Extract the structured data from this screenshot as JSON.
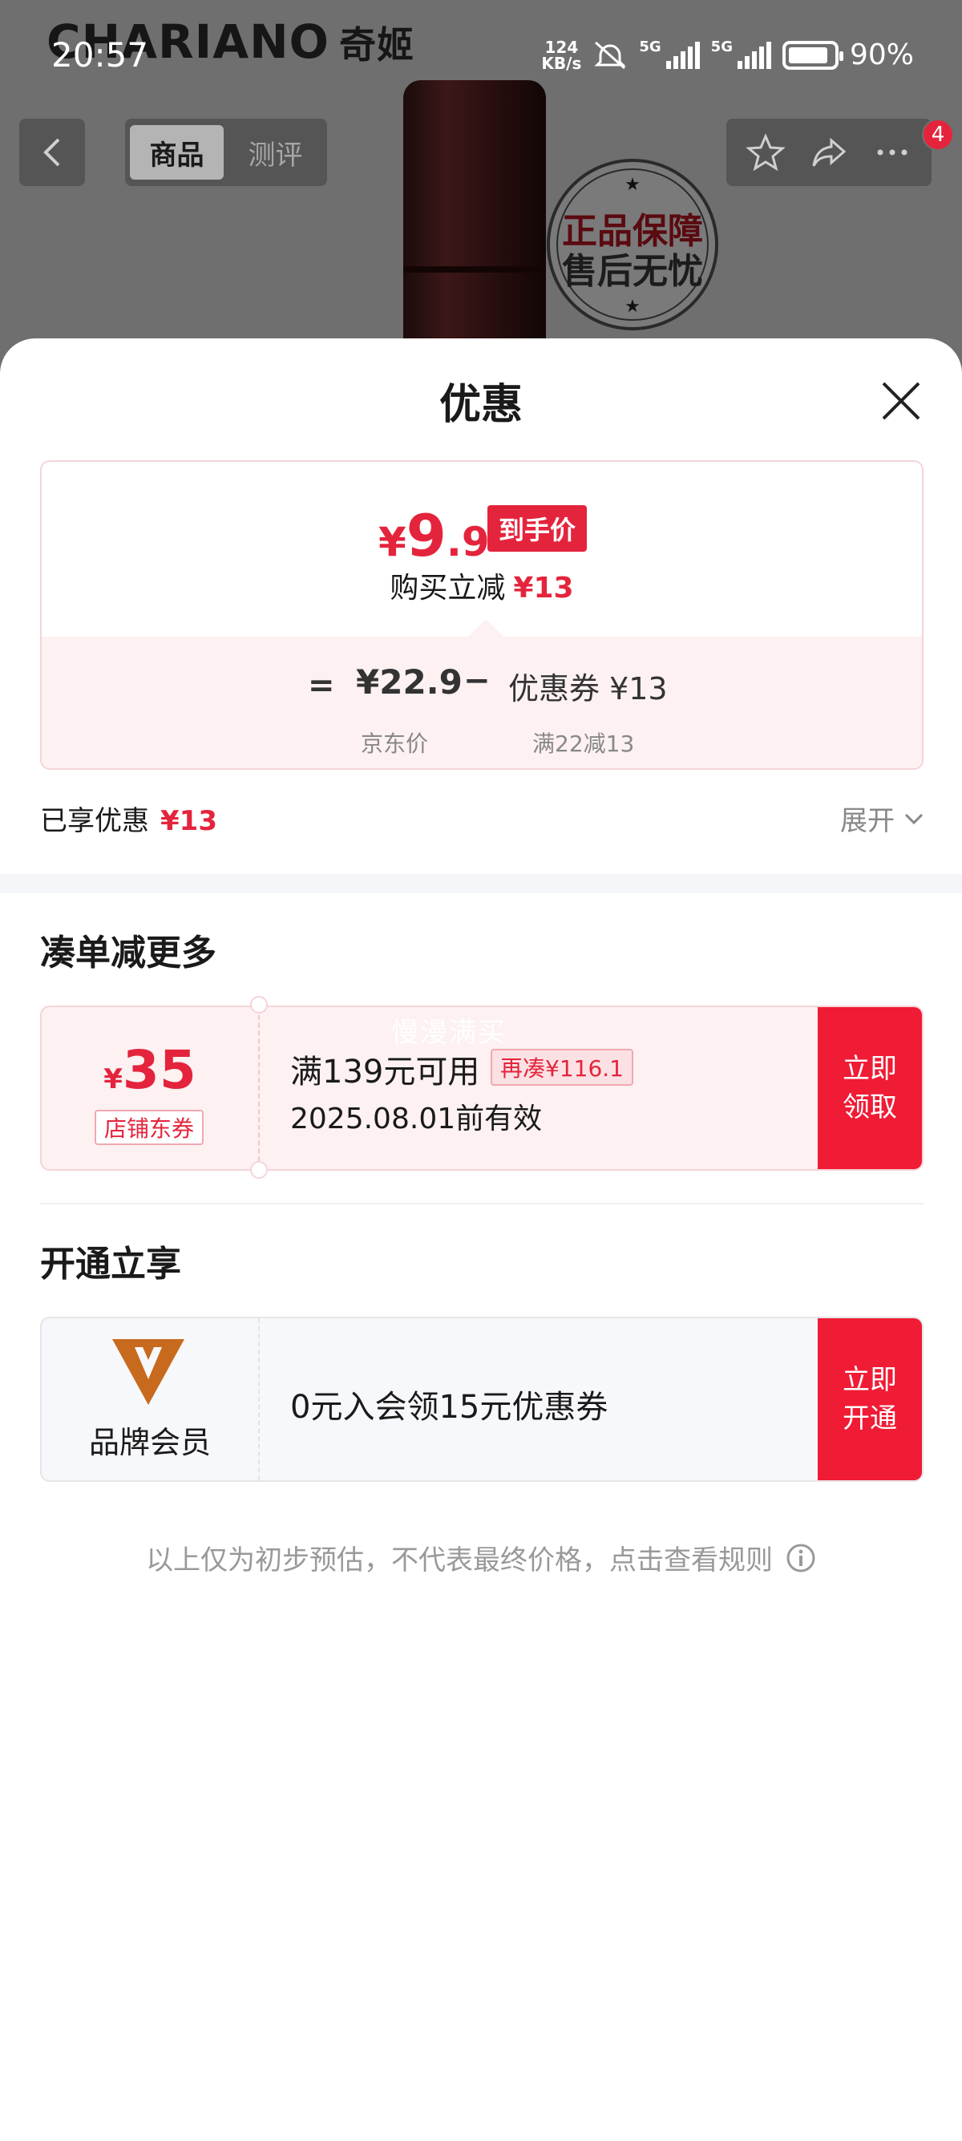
{
  "background": {
    "brand": "CHARIANO",
    "brand_cn": "奇姬",
    "seal_line1": "正品保障",
    "seal_line2": "售后无忧"
  },
  "status_bar": {
    "time": "20:57",
    "speed_value": "124",
    "speed_unit": "KB/s",
    "network1": "5G",
    "network2": "5G",
    "battery": "90%"
  },
  "nav": {
    "tabs": [
      {
        "label": "商品",
        "active": true
      },
      {
        "label": "测评",
        "active": false
      }
    ],
    "badge_count": "4"
  },
  "sheet": {
    "title": "优惠",
    "final_price": {
      "currency": "¥",
      "integer": "9",
      "decimal": ".9",
      "tag": "到手价",
      "reduce_label": "购买立减",
      "reduce_amount": "¥13"
    },
    "breakdown": {
      "equals": "=",
      "jd_price": "¥22.9",
      "minus": "−",
      "coupon": "优惠券 ¥13",
      "jd_label": "京东价",
      "coupon_condition": "满22减13"
    },
    "enjoyed": {
      "label": "已享优惠",
      "amount": "¥13",
      "expand_label": "展开"
    },
    "section_more": {
      "title": "凑单减更多",
      "watermark": "慢漫满买",
      "coupon": {
        "currency": "¥",
        "value": "35",
        "type": "店铺东券",
        "condition": "满139元可用",
        "more_needed": "再凑¥116.1",
        "valid_until": "2025.08.01前有效",
        "action_line1": "立即",
        "action_line2": "领取"
      }
    },
    "section_member": {
      "title": "开通立享",
      "label": "品牌会员",
      "offer": "0元入会领15元优惠券",
      "action_line1": "立即",
      "action_line2": "开通"
    },
    "footnote": "以上仅为初步预估，不代表最终价格，点击查看规则"
  },
  "colors": {
    "accent_red": "#e4243c",
    "button_red": "#f01b35",
    "card_pink": "#fdf1f2",
    "member_gold": "#c86a1e"
  }
}
